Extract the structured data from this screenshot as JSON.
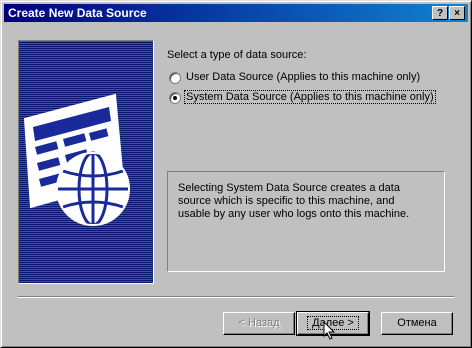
{
  "window": {
    "title": "Create New Data Source",
    "help_label": "?",
    "close_label": "×"
  },
  "main": {
    "prompt": "Select a type of data source:",
    "options": [
      {
        "label": "User Data Source (Applies to this machine only)",
        "selected": false
      },
      {
        "label": "System Data Source (Applies to this machine only)",
        "selected": true
      }
    ],
    "description": "Selecting System Data Source creates a data source which is specific to this machine, and usable by any user who logs onto this machine."
  },
  "buttons": {
    "back": "< Назад",
    "next": "Далее >",
    "cancel": "Отмена"
  },
  "icons": {
    "illustration": "data-source-illustration",
    "cursor": "mouse-pointer-icon"
  }
}
